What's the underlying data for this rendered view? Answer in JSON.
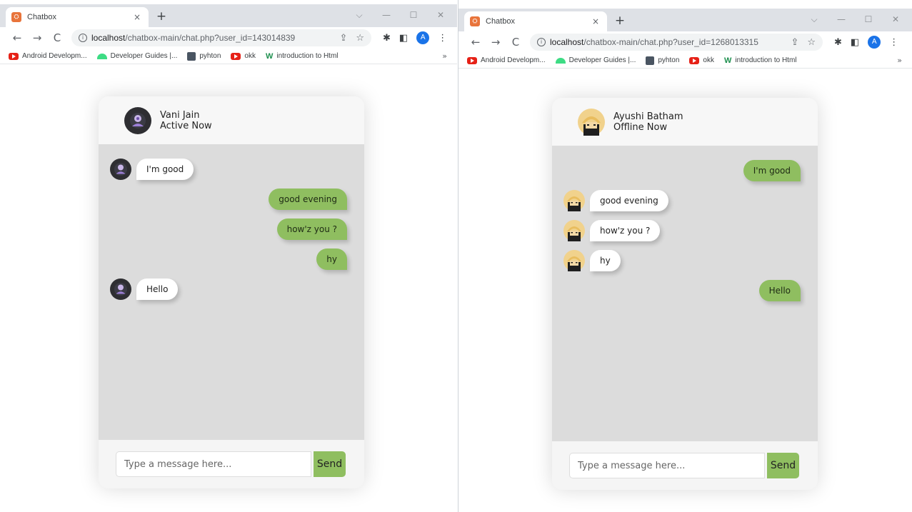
{
  "windows": [
    {
      "tab": {
        "title": "Chatbox",
        "close": "×",
        "new_tab": "+"
      },
      "window_controls": [
        "⌵",
        "—",
        "☐",
        "✕"
      ],
      "nav": {
        "back": "←",
        "forward": "→",
        "reload": "C"
      },
      "address": {
        "host": "localhost",
        "path": "/chatbox-main/chat.php?user_id=143014839"
      },
      "bookmarks": [
        {
          "icon": "youtube-icon",
          "label": "Android Developm..."
        },
        {
          "icon": "android-icon",
          "label": "Developer Guides |..."
        },
        {
          "icon": "book-icon",
          "label": "pyhton"
        },
        {
          "icon": "youtube-icon",
          "label": "okk"
        },
        {
          "icon": "w3-icon",
          "label": "introduction to Html"
        }
      ],
      "bookmarks_more": "»",
      "profile_initial": "A",
      "chat": {
        "name": "Vani Jain",
        "status": "Active Now",
        "avatar": "purple-avatar",
        "messages": [
          {
            "dir": "incoming",
            "text": "I'm good"
          },
          {
            "dir": "outgoing",
            "text": "good evening"
          },
          {
            "dir": "outgoing",
            "text": "how'z you ?"
          },
          {
            "dir": "outgoing",
            "text": "hy"
          },
          {
            "dir": "incoming",
            "text": "Hello"
          }
        ],
        "input_placeholder": "Type a message here...",
        "send_label": "Send"
      }
    },
    {
      "tab": {
        "title": "Chatbox",
        "close": "×",
        "new_tab": "+"
      },
      "window_controls": [
        "⌵",
        "—",
        "☐",
        "✕"
      ],
      "nav": {
        "back": "←",
        "forward": "→",
        "reload": "C"
      },
      "address": {
        "host": "localhost",
        "path": "/chatbox-main/chat.php?user_id=1268013315"
      },
      "bookmarks": [
        {
          "icon": "youtube-icon",
          "label": "Android Developm..."
        },
        {
          "icon": "android-icon",
          "label": "Developer Guides |..."
        },
        {
          "icon": "book-icon",
          "label": "pyhton"
        },
        {
          "icon": "youtube-icon",
          "label": "okk"
        },
        {
          "icon": "w3-icon",
          "label": "introduction to Html"
        }
      ],
      "bookmarks_more": "»",
      "profile_initial": "A",
      "chat": {
        "name": "Ayushi Batham",
        "status": "Offline Now",
        "avatar": "blonde-avatar",
        "messages": [
          {
            "dir": "outgoing",
            "text": "I'm good"
          },
          {
            "dir": "incoming",
            "text": "good evening"
          },
          {
            "dir": "incoming",
            "text": "how'z you ?"
          },
          {
            "dir": "incoming",
            "text": "hy"
          },
          {
            "dir": "outgoing",
            "text": "Hello"
          }
        ],
        "input_placeholder": "Type a message here...",
        "send_label": "Send"
      }
    }
  ],
  "colors": {
    "outgoing_bubble": "#8fbe60",
    "incoming_bubble": "#ffffff",
    "chat_area": "#dcdcdc",
    "send_button": "#8fbe60"
  }
}
